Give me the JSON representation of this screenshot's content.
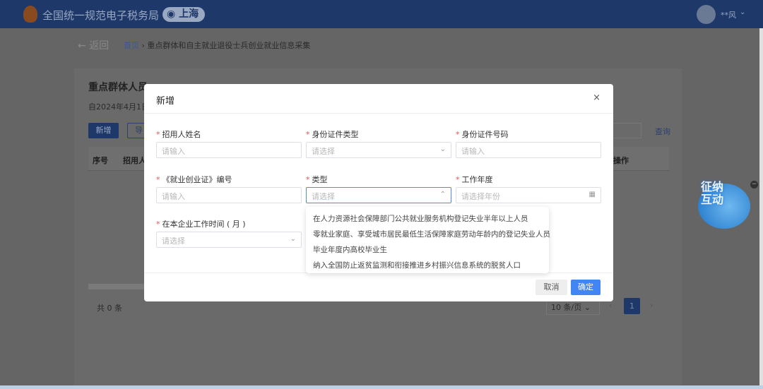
{
  "header": {
    "title": "全国统一规范电子税务局",
    "city": "上海",
    "user": "**风"
  },
  "nav": {
    "back": "返回",
    "home": "首页",
    "separator": "›",
    "current": "重点群体和自主就业退役士兵创业就业信息采集"
  },
  "card": {
    "title": "重点群体人员",
    "subtitle": "自2024年4月1日",
    "add": "新增",
    "import": "导",
    "query": "查询",
    "columns": [
      "序号",
      "招用人",
      "操作"
    ],
    "total": "共 0 条",
    "page_size": "10 条/页",
    "page": "1"
  },
  "mascot": {
    "text": "征纳互动"
  },
  "modal": {
    "title": "新增",
    "close": "×",
    "fields": [
      {
        "label": "招用人姓名",
        "placeholder": "请输入",
        "type": "input"
      },
      {
        "label": "身份证件类型",
        "placeholder": "请选择",
        "type": "select"
      },
      {
        "label": "身份证件号码",
        "placeholder": "请输入",
        "type": "input"
      },
      {
        "label": "《就业创业证》编号",
        "placeholder": "请输入",
        "type": "input"
      },
      {
        "label": "类型",
        "placeholder": "请选择",
        "type": "select-open"
      },
      {
        "label": "工作年度",
        "placeholder": "请选择年份",
        "type": "date"
      },
      {
        "label": "在本企业工作时间 ( 月 )",
        "placeholder": "请选择",
        "type": "select"
      }
    ],
    "required_mark": "*",
    "cancel": "取消",
    "confirm": "确定",
    "options": [
      "在人力资源社会保障部门公共就业服务机构登记失业半年以上人员",
      "零就业家庭、享受城市居民最低生活保障家庭劳动年龄内的登记失业人员",
      "毕业年度内高校毕业生",
      "纳入全国防止返贫监测和衔接推进乡村振兴信息系统的脱贫人口"
    ]
  },
  "colors": {
    "header": "#1d3869",
    "primary": "#4285f4",
    "required": "#e45656"
  }
}
